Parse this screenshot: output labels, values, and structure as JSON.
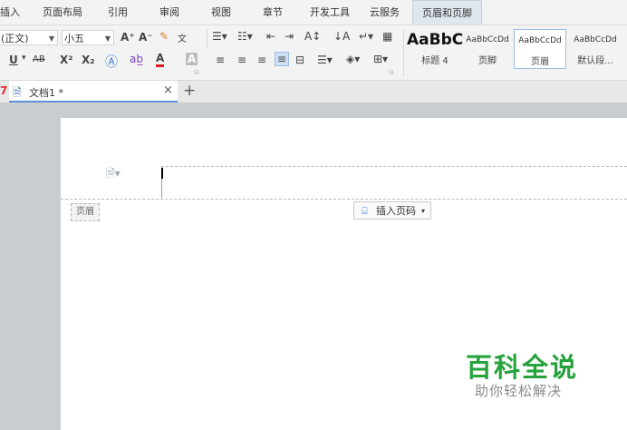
{
  "menu": {
    "items": [
      "插入",
      "页面布局",
      "引用",
      "审阅",
      "视图",
      "章节",
      "开发工具",
      "云服务",
      "页眉和页脚"
    ],
    "active": "页眉和页脚"
  },
  "ribbon": {
    "font_name": "(正文)",
    "font_size": "小五",
    "grow_font_icon": "A⁺",
    "shrink_font_icon": "A⁻",
    "phonetic_label": "文",
    "bold": "B",
    "italic": "I",
    "underline": "U",
    "strike": "AB",
    "superscript": "X²",
    "subscript": "X₂",
    "styles": [
      {
        "sample": "AaBbC",
        "name": "标题 4"
      },
      {
        "sample": "AaBbCcDd",
        "name": "页脚"
      },
      {
        "sample": "AaBbCcDd",
        "name": "页眉"
      },
      {
        "sample": "AaBbCcDd",
        "name": "默认段..."
      }
    ]
  },
  "tabs": {
    "left_marker": "7",
    "doc_title": "文档1 *",
    "close": "×",
    "new_tab": "+"
  },
  "page": {
    "header_tag": "页眉",
    "insert_page_number": "插入页码"
  },
  "watermark": {
    "title": "百科全说",
    "subtitle": "助你轻松解决"
  },
  "colors": {
    "accent": "#5b8fd8",
    "watermark_green": "#26a33c",
    "menu_active_bg": "#dfe6ee"
  }
}
